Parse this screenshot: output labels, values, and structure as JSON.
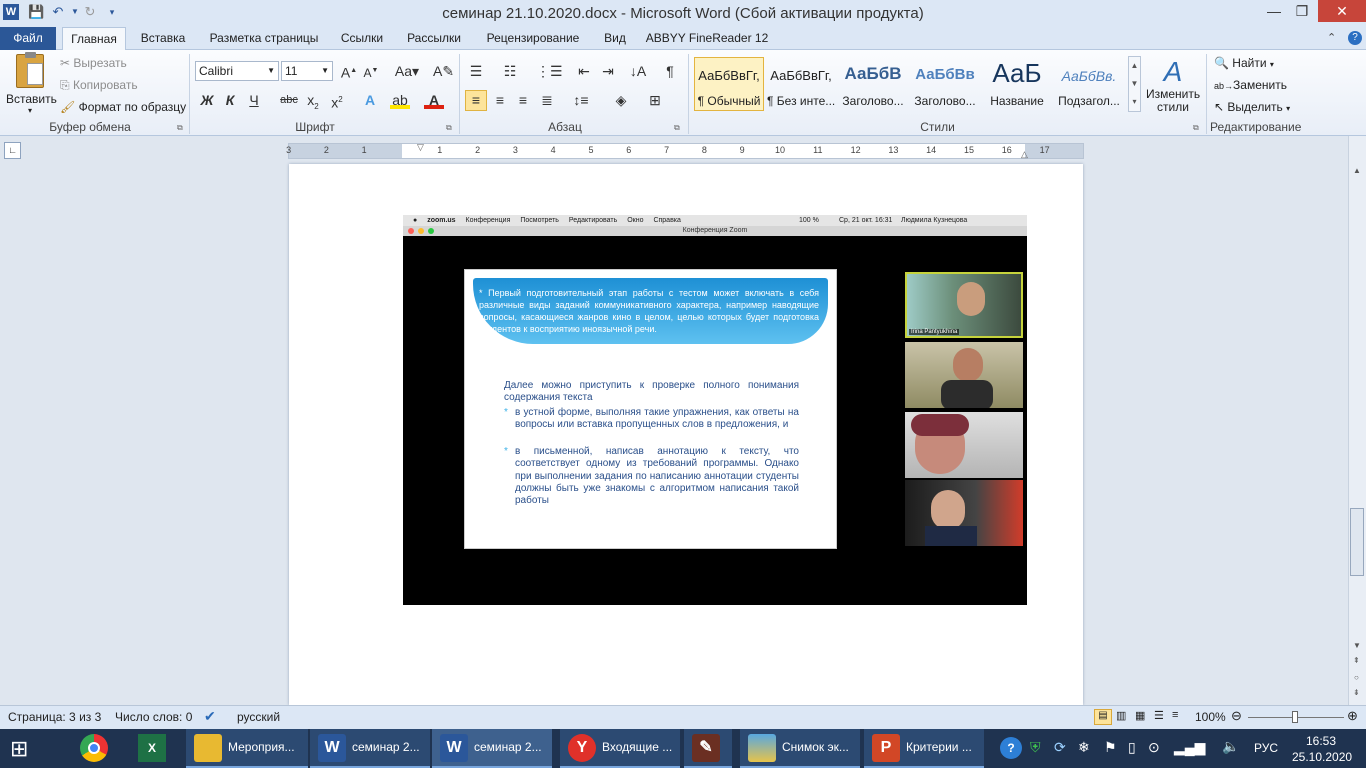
{
  "title": "семинар 21.10.2020.docx - Microsoft Word (Сбой активации продукта)",
  "tabs": [
    "Файл",
    "Главная",
    "Вставка",
    "Разметка страницы",
    "Ссылки",
    "Рассылки",
    "Рецензирование",
    "Вид",
    "ABBYY FineReader 12"
  ],
  "clipboard": {
    "paste": "Вставить",
    "cut": "Вырезать",
    "copy": "Копировать",
    "format": "Формат по образцу",
    "label": "Буфер обмена"
  },
  "font": {
    "name": "Calibri",
    "size": "11",
    "label": "Шрифт",
    "bold": "Ж",
    "italic": "К",
    "underline": "Ч"
  },
  "paragraph": {
    "label": "Абзац"
  },
  "styles": {
    "label": "Стили",
    "items": [
      {
        "sample": "АаБбВвГг,",
        "name": "¶ Обычный"
      },
      {
        "sample": "АаБбВвГг,",
        "name": "¶ Без инте..."
      },
      {
        "sample": "АаБбВ",
        "name": "Заголово..."
      },
      {
        "sample": "АаБбВв",
        "name": "Заголово..."
      },
      {
        "sample": "АаБ",
        "name": "Название"
      },
      {
        "sample": "АаБбВв.",
        "name": "Подзагол..."
      }
    ],
    "change": "Изменить стили"
  },
  "editing": {
    "find": "Найти",
    "replace": "Заменить",
    "select": "Выделить",
    "label": "Редактирование"
  },
  "ruler": {
    "numbers": [
      "3",
      "2",
      "1",
      "1",
      "2",
      "3",
      "4",
      "5",
      "6",
      "7",
      "8",
      "9",
      "10",
      "11",
      "12",
      "13",
      "14",
      "15",
      "16",
      "17"
    ]
  },
  "zoom": {
    "menu": [
      "zoom.us",
      "Конференция",
      "Посмотреть",
      "Редактировать",
      "Окно",
      "Справка"
    ],
    "status": "100 %",
    "datetime": "Ср, 21 окт.  16:31",
    "user": "Людмила Кузнецова",
    "window_title": "Конференция Zoom",
    "participant": "Irina Pantyukhina"
  },
  "slide": {
    "header": "* Первый подготовительный этап работы с тестом может включать в себя различные виды заданий коммуникативного характера, например наводящие вопросы, касающиеся жанров кино в целом, целью которых будет подготовка студентов к восприятию иноязычной речи.",
    "intro": "Далее можно приступить к проверке полного понимания содержания текста",
    "bullets": [
      "в устной форме, выполняя такие упражнения, как ответы на вопросы или вставка пропущенных слов в предложения, и",
      "в письменной, написав аннотацию к тексту, что соответствует одному из требований программы. Однако при выполнении задания по написанию аннотации студенты должны быть уже знакомы с алгоритмом написания такой работы"
    ]
  },
  "status": {
    "page": "Страница: 3 из 3",
    "words": "Число слов: 0",
    "lang": "русский",
    "zoom": "100%"
  },
  "taskbar": {
    "items": [
      "Мероприя...",
      "семинар 2...",
      "семинар 2...",
      "Входящие ...",
      "",
      "Снимок эк...",
      "Критерии ..."
    ],
    "lang": "РУС",
    "time": "16:53",
    "date": "25.10.2020"
  }
}
